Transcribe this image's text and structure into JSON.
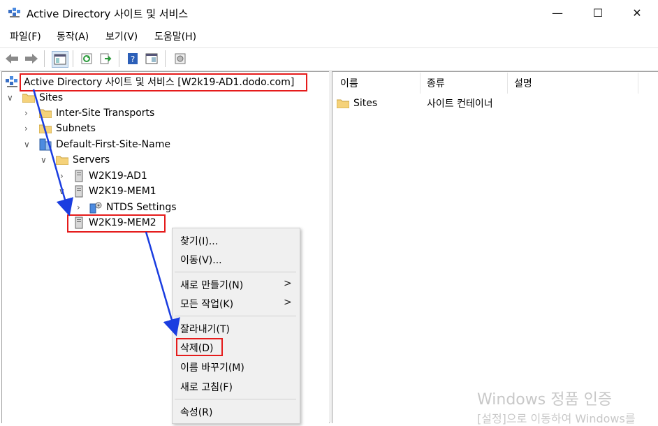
{
  "window": {
    "title": "Active Directory 사이트 및 서비스",
    "minimize": "—",
    "maximize": "☐",
    "close": "✕"
  },
  "menu": [
    "파일(F)",
    "동작(A)",
    "보기(V)",
    "도움말(H)"
  ],
  "toolbar": {
    "icons": [
      "back-icon",
      "forward-icon",
      "show-hide-tree-icon",
      "refresh-icon",
      "export-list-icon",
      "help-icon",
      "properties-icon",
      "mmc-icon"
    ]
  },
  "tree": {
    "root": "Active Directory 사이트 및 서비스 [W2k19-AD1.dodo.com]",
    "sites": "Sites",
    "inter_site": "Inter-Site Transports",
    "subnets": "Subnets",
    "default_site": "Default-First-Site-Name",
    "servers": "Servers",
    "server1": "W2K19-AD1",
    "server2": "W2K19-MEM1",
    "ntds": "NTDS Settings",
    "server3": "W2K19-MEM2"
  },
  "list": {
    "columns": [
      "이름",
      "종류",
      "설명"
    ],
    "rows": [
      {
        "name": "Sites",
        "type": "사이트 컨테이너",
        "desc": ""
      }
    ]
  },
  "context_menu": {
    "find": "찾기(I)...",
    "move": "이동(V)...",
    "new": "새로 만들기(N)",
    "all_tasks": "모든 작업(K)",
    "cut": "잘라내기(T)",
    "delete": "삭제(D)",
    "rename": "이름 바꾸기(M)",
    "refresh": "새로 고침(F)",
    "properties": "속성(R)",
    "submenu_arrow": ">"
  },
  "watermark": {
    "line1": "Windows 정품 인증",
    "line2": "[설정]으로 이동하여 Windows를"
  },
  "colors": {
    "highlight_box": "#e51b1b",
    "annotation_arrow": "#1a3de0",
    "folder": "#f5d27a"
  }
}
